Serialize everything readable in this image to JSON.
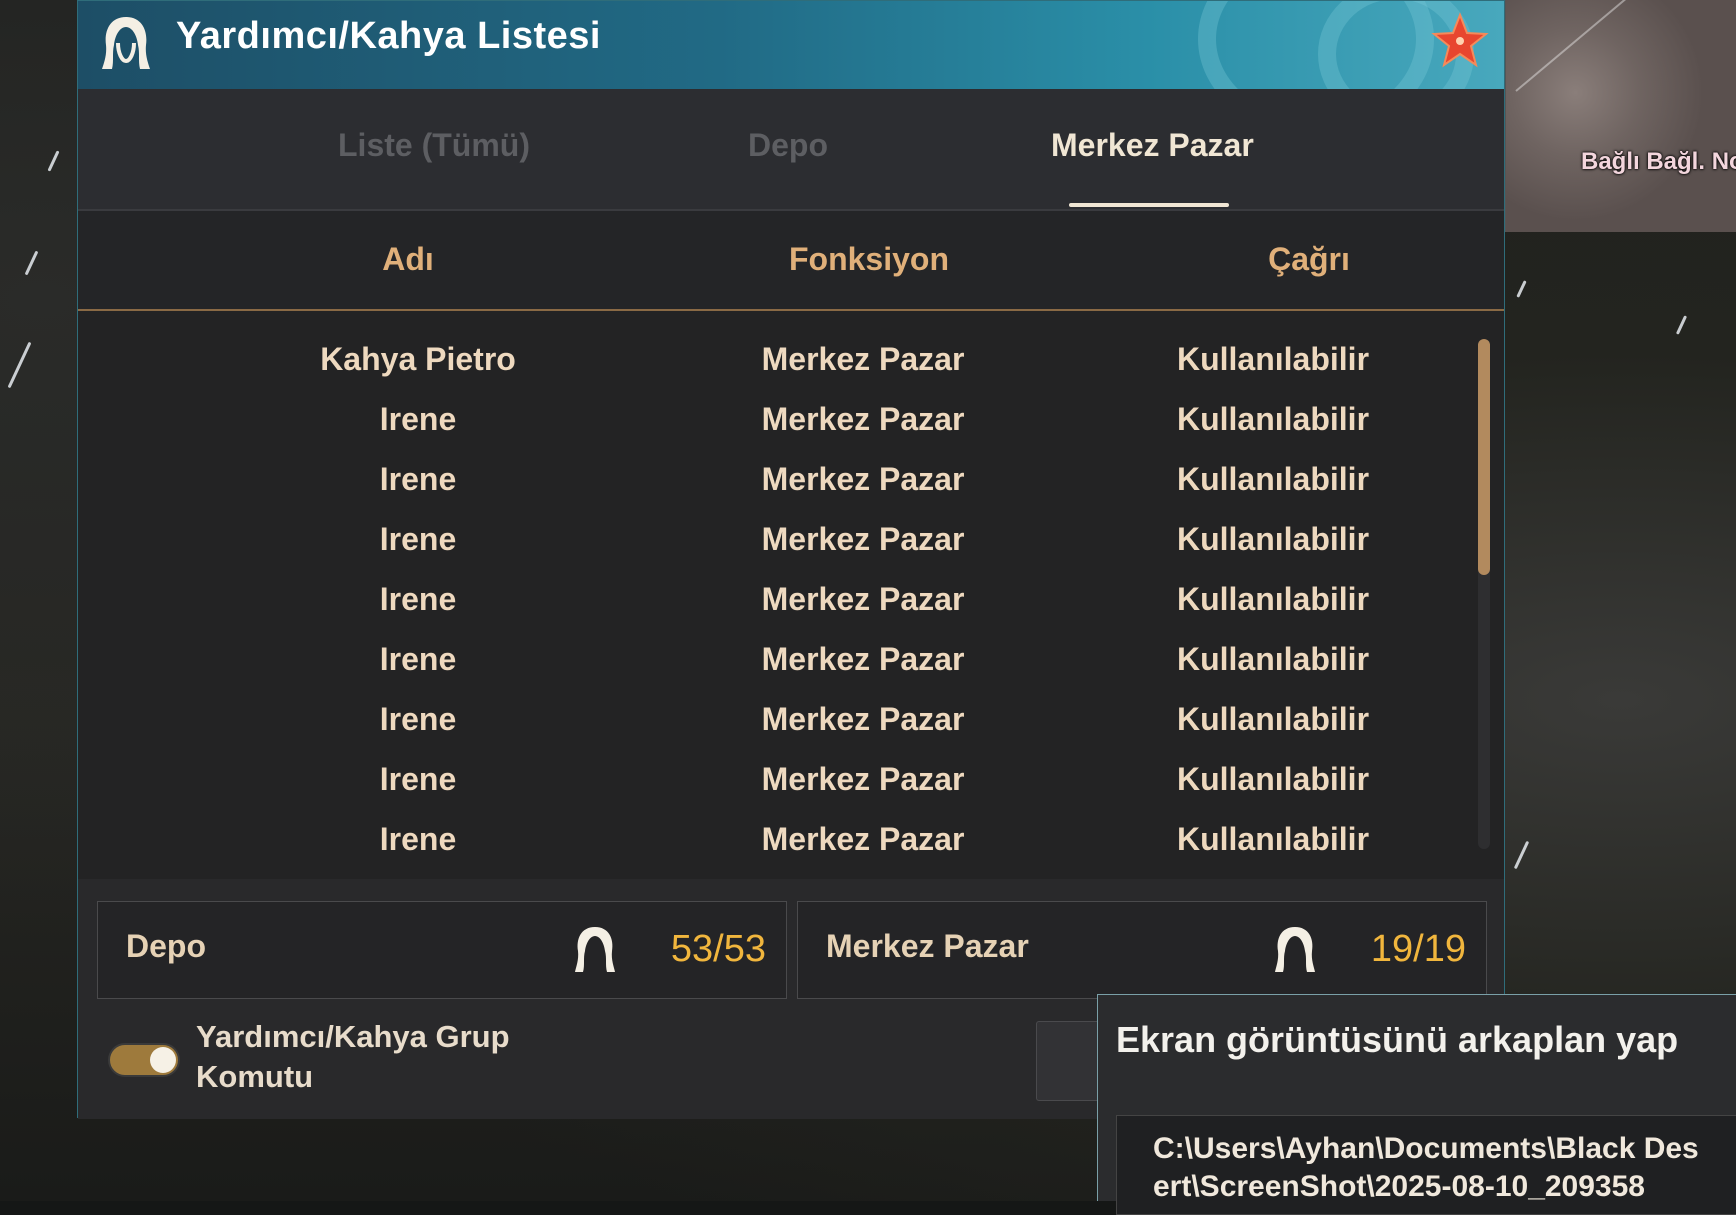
{
  "window": {
    "title": "Yardımcı/Kahya Listesi",
    "icon": "maid-silhouette-icon",
    "close_icon": "starfish-close-icon"
  },
  "tabs": [
    {
      "label": "Liste (Tümü)",
      "active": false
    },
    {
      "label": "Depo",
      "active": false
    },
    {
      "label": "Merkez Pazar",
      "active": true
    }
  ],
  "columns": {
    "name": "Adı",
    "function": "Fonksiyon",
    "call": "Çağrı"
  },
  "rows": [
    {
      "name": "Kahya Pietro",
      "function": "Merkez Pazar",
      "call": "Kullanılabilir"
    },
    {
      "name": "Irene",
      "function": "Merkez Pazar",
      "call": "Kullanılabilir"
    },
    {
      "name": "Irene",
      "function": "Merkez Pazar",
      "call": "Kullanılabilir"
    },
    {
      "name": "Irene",
      "function": "Merkez Pazar",
      "call": "Kullanılabilir"
    },
    {
      "name": "Irene",
      "function": "Merkez Pazar",
      "call": "Kullanılabilir"
    },
    {
      "name": "Irene",
      "function": "Merkez Pazar",
      "call": "Kullanılabilir"
    },
    {
      "name": "Irene",
      "function": "Merkez Pazar",
      "call": "Kullanılabilir"
    },
    {
      "name": "Irene",
      "function": "Merkez Pazar",
      "call": "Kullanılabilir"
    },
    {
      "name": "Irene",
      "function": "Merkez Pazar",
      "call": "Kullanılabilir"
    }
  ],
  "summary": {
    "depot": {
      "label": "Depo",
      "count": "53/53",
      "icon": "maid-silhouette-icon"
    },
    "market": {
      "label": "Merkez Pazar",
      "count": "19/19",
      "icon": "maid-silhouette-icon"
    }
  },
  "group_command": {
    "label_line1": "Yardımcı/Kahya Grup",
    "label_line2": "Komutu",
    "enabled": true
  },
  "minimap": {
    "label": "Bağlı Bağl. No"
  },
  "screenshot_popup": {
    "title": "Ekran görüntüsünü arkaplan yap",
    "path": "C:\\Users\\Ayhan\\Documents\\Black Desert\\ScreenShot\\2025-08-10_209358"
  },
  "colors": {
    "accent_gold": "#e0b07a",
    "count_yellow": "#f1b63d",
    "title_teal": "#216a85"
  }
}
